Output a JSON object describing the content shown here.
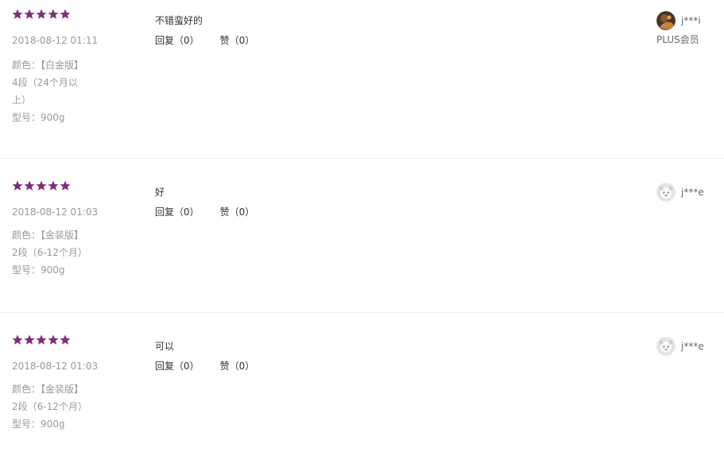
{
  "colors": {
    "star": "#7d2e7a",
    "secondary_text": "#999999",
    "primary_text": "#333333",
    "divider": "#ececec"
  },
  "reviews": [
    {
      "rating": 5,
      "date": "2018-08-12 01:11",
      "attrs": [
        "颜色：【白金版】",
        "4段（24个月以",
        "上）",
        "型号：900g"
      ],
      "content": "不错蛮好的",
      "reply_label": "回复（0）",
      "like_label": "赞（0）",
      "user_name": "j***i",
      "user_level": "PLUS会员",
      "avatar_icon": "photo-avatar-icon"
    },
    {
      "rating": 5,
      "date": "2018-08-12 01:03",
      "attrs": [
        "颜色：【金装版】",
        "2段（6-12个月）",
        "型号：900g"
      ],
      "content": "好",
      "reply_label": "回复（0）",
      "like_label": "赞（0）",
      "user_name": "j***e",
      "user_level": "",
      "avatar_icon": "default-avatar-icon"
    },
    {
      "rating": 5,
      "date": "2018-08-12 01:03",
      "attrs": [
        "颜色：【金装版】",
        "2段（6-12个月）",
        "型号：900g"
      ],
      "content": "可以",
      "reply_label": "回复（0）",
      "like_label": "赞（0）",
      "user_name": "j***e",
      "user_level": "",
      "avatar_icon": "default-avatar-icon"
    }
  ]
}
